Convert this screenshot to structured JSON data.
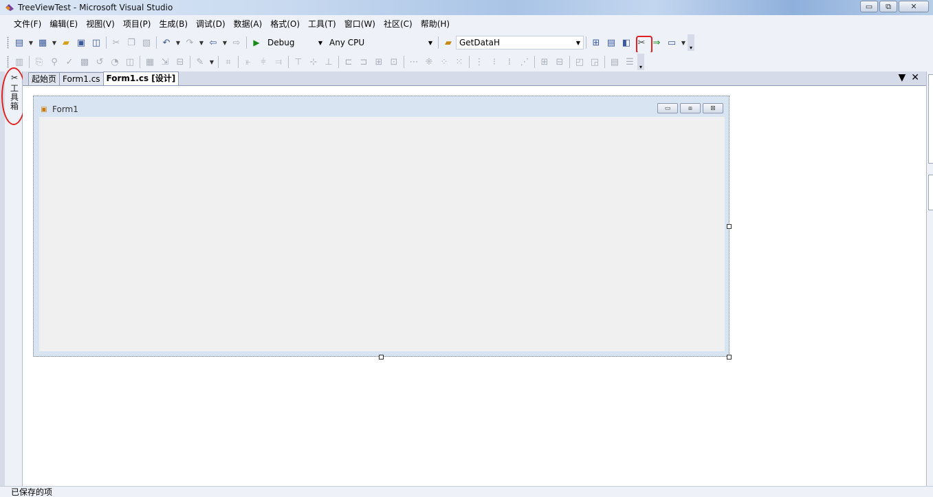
{
  "window": {
    "title": "TreeViewTest - Microsoft Visual Studio",
    "minimize_glyph": "▭",
    "restore_glyph": "⧉",
    "close_glyph": "✕"
  },
  "menu": [
    {
      "label": "文件(F)"
    },
    {
      "label": "编辑(E)"
    },
    {
      "label": "视图(V)"
    },
    {
      "label": "项目(P)"
    },
    {
      "label": "生成(B)"
    },
    {
      "label": "调试(D)"
    },
    {
      "label": "数据(A)"
    },
    {
      "label": "格式(O)"
    },
    {
      "label": "工具(T)"
    },
    {
      "label": "窗口(W)"
    },
    {
      "label": "社区(C)"
    },
    {
      "label": "帮助(H)"
    }
  ],
  "toolbar": {
    "config": "Debug",
    "platform": "Any CPU",
    "find": "GetDataH",
    "dropdown_arrow": "▼",
    "overflow_glyph": "▾"
  },
  "toolbox": {
    "label": "工具箱",
    "icon_glyph": "✂"
  },
  "tabs": [
    {
      "label": "起始页"
    },
    {
      "label": "Form1.cs"
    },
    {
      "label": "Form1.cs [设计]"
    }
  ],
  "doc_controls": {
    "dropdown": "▼",
    "close": "✕"
  },
  "form": {
    "title": "Form1",
    "min": "▭",
    "max": "⧈",
    "close": "⊠"
  },
  "status": {
    "text": "已保存的项"
  },
  "colors": {
    "annotation": "#e02020",
    "run": "#1a8a1a"
  }
}
